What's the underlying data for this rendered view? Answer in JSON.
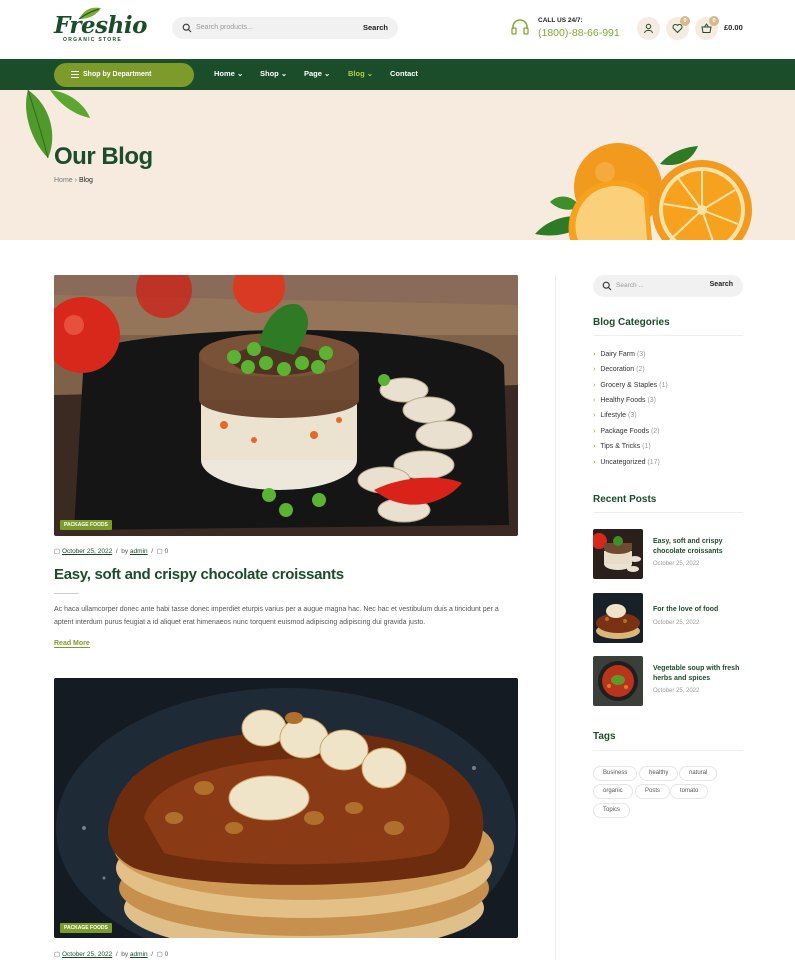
{
  "header": {
    "logo": "Freshio",
    "logo_sub": "ORGANIC STORE",
    "search_placeholder": "Search products...",
    "search_button": "Search",
    "call_label": "CALL US 24/7:",
    "call_number": "(1800)-88-66-991",
    "wishlist_count": "0",
    "cart_count": "0",
    "cart_total": "£0.00"
  },
  "nav": {
    "department_label": "Shop by Department",
    "items": [
      "Home",
      "Shop",
      "Page",
      "Blog",
      "Contact"
    ],
    "active": "Blog"
  },
  "hero": {
    "title": "Our Blog",
    "breadcrumb_home": "Home",
    "breadcrumb_sep": "›",
    "breadcrumb_current": "Blog"
  },
  "posts": [
    {
      "category": "PACKAGE FOODS",
      "date": "October 25, 2022",
      "by": "by",
      "author": "admin",
      "comments": "0",
      "title": "Easy, soft and crispy chocolate croissants",
      "excerpt": "Ac haca ullamcorper donec ante habi tasse donec imperdiet eturpis varius per a augue magna hac. Nec hac et vestibulum duis a tincidunt per a aptent interdum purus feugiat a id aliquet erat himenaeos nunc torquent euismod adipiscing adipiscing dui gravida justo.",
      "read_more": "Read More"
    },
    {
      "category": "PACKAGE FOODS",
      "date": "October 25, 2022",
      "by": "by",
      "author": "admin",
      "comments": "0"
    }
  ],
  "sidebar": {
    "search_placeholder": "Search ...",
    "search_button": "Search",
    "categories_title": "Blog Categories",
    "categories": [
      {
        "name": "Dairy Farm",
        "count": "(3)"
      },
      {
        "name": "Decoration",
        "count": "(2)"
      },
      {
        "name": "Grocery & Staples",
        "count": "(1)"
      },
      {
        "name": "Healthy Foods",
        "count": "(3)"
      },
      {
        "name": "Lifestyle",
        "count": "(3)"
      },
      {
        "name": "Package Foods",
        "count": "(2)"
      },
      {
        "name": "Tips & Tricks",
        "count": "(1)"
      },
      {
        "name": "Uncategorized",
        "count": "(17)"
      }
    ],
    "recent_title": "Recent Posts",
    "recent": [
      {
        "title": "Easy, soft and crispy chocolate croissants",
        "date": "October 25, 2022"
      },
      {
        "title": "For the love of food",
        "date": "October 25, 2022"
      },
      {
        "title": "Vegetable soup with fresh herbs and spices",
        "date": "October 25, 2022"
      }
    ],
    "tags_title": "Tags",
    "tags": [
      "Business",
      "healthy",
      "natural",
      "organic",
      "Posts",
      "tomato",
      "Topics"
    ]
  },
  "colors": {
    "brand_green": "#1b4d2a",
    "accent_olive": "#7d9b2b",
    "hero_bg": "#f7ebe0"
  }
}
